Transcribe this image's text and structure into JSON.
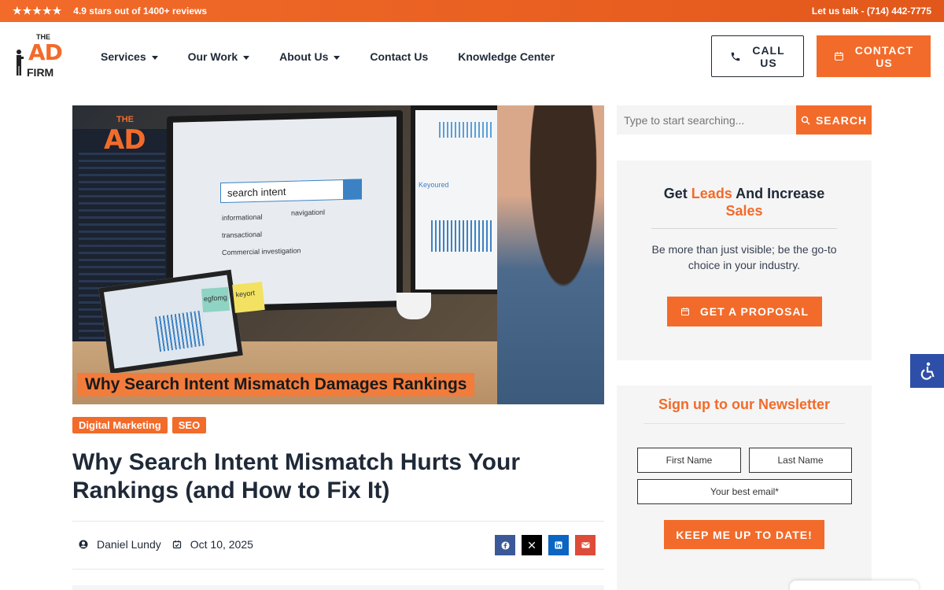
{
  "topbar": {
    "stars": "★★★★★",
    "rating_text": "4.9 stars out of 1400+ reviews",
    "phone_text": "Let us talk - (714) 442-7775"
  },
  "logo": {
    "the": "THE",
    "ad": "AD",
    "firm": "FIRM"
  },
  "nav": {
    "items": [
      {
        "label": "Services",
        "has_caret": true
      },
      {
        "label": "Our Work",
        "has_caret": true
      },
      {
        "label": "About Us",
        "has_caret": true
      },
      {
        "label": "Contact Us",
        "has_caret": false
      },
      {
        "label": "Knowledge Center",
        "has_caret": false
      }
    ]
  },
  "header_buttons": {
    "call_line1": "CALL",
    "call_line2": "US",
    "contact_line1": "CONTACT",
    "contact_line2": "US"
  },
  "hero": {
    "logo_the": "THE",
    "logo_ad": "AD",
    "search_text": "search intent",
    "checkboxes": [
      "informational",
      "navigationl",
      "transactional",
      "Commercial investigation"
    ],
    "note1": "egfomg",
    "note2": "keyort",
    "panel_label": "Keyoured",
    "caption": "Why Search Intent Mismatch Damages Rankings"
  },
  "post": {
    "tags": [
      "Digital Marketing",
      "SEO"
    ],
    "title": "Why Search Intent Mismatch Hurts Your Rankings (and How to Fix It)",
    "author": "Daniel Lundy",
    "date": "Oct 10, 2025",
    "share_icons": [
      "facebook-icon",
      "x-icon",
      "linkedin-icon",
      "email-icon"
    ]
  },
  "sidebar": {
    "search_placeholder": "Type to start searching...",
    "search_button": "SEARCH",
    "leads": {
      "title_part1": "Get ",
      "title_highlight1": "Leads",
      "title_part2": " And Increase",
      "title_highlight2": "Sales",
      "body": "Be more than just visible; be the go-to choice in your industry.",
      "button": "GET A PROPOSAL"
    },
    "newsletter": {
      "title": "Sign up to our Newsletter",
      "first_name": "First Name",
      "last_name": "Last Name",
      "email": "Your best email*",
      "button": "KEEP ME UP TO DATE!"
    }
  },
  "colors": {
    "accent": "#f26b2a",
    "text": "#1f2937",
    "a11y": "#2e4fa8"
  }
}
